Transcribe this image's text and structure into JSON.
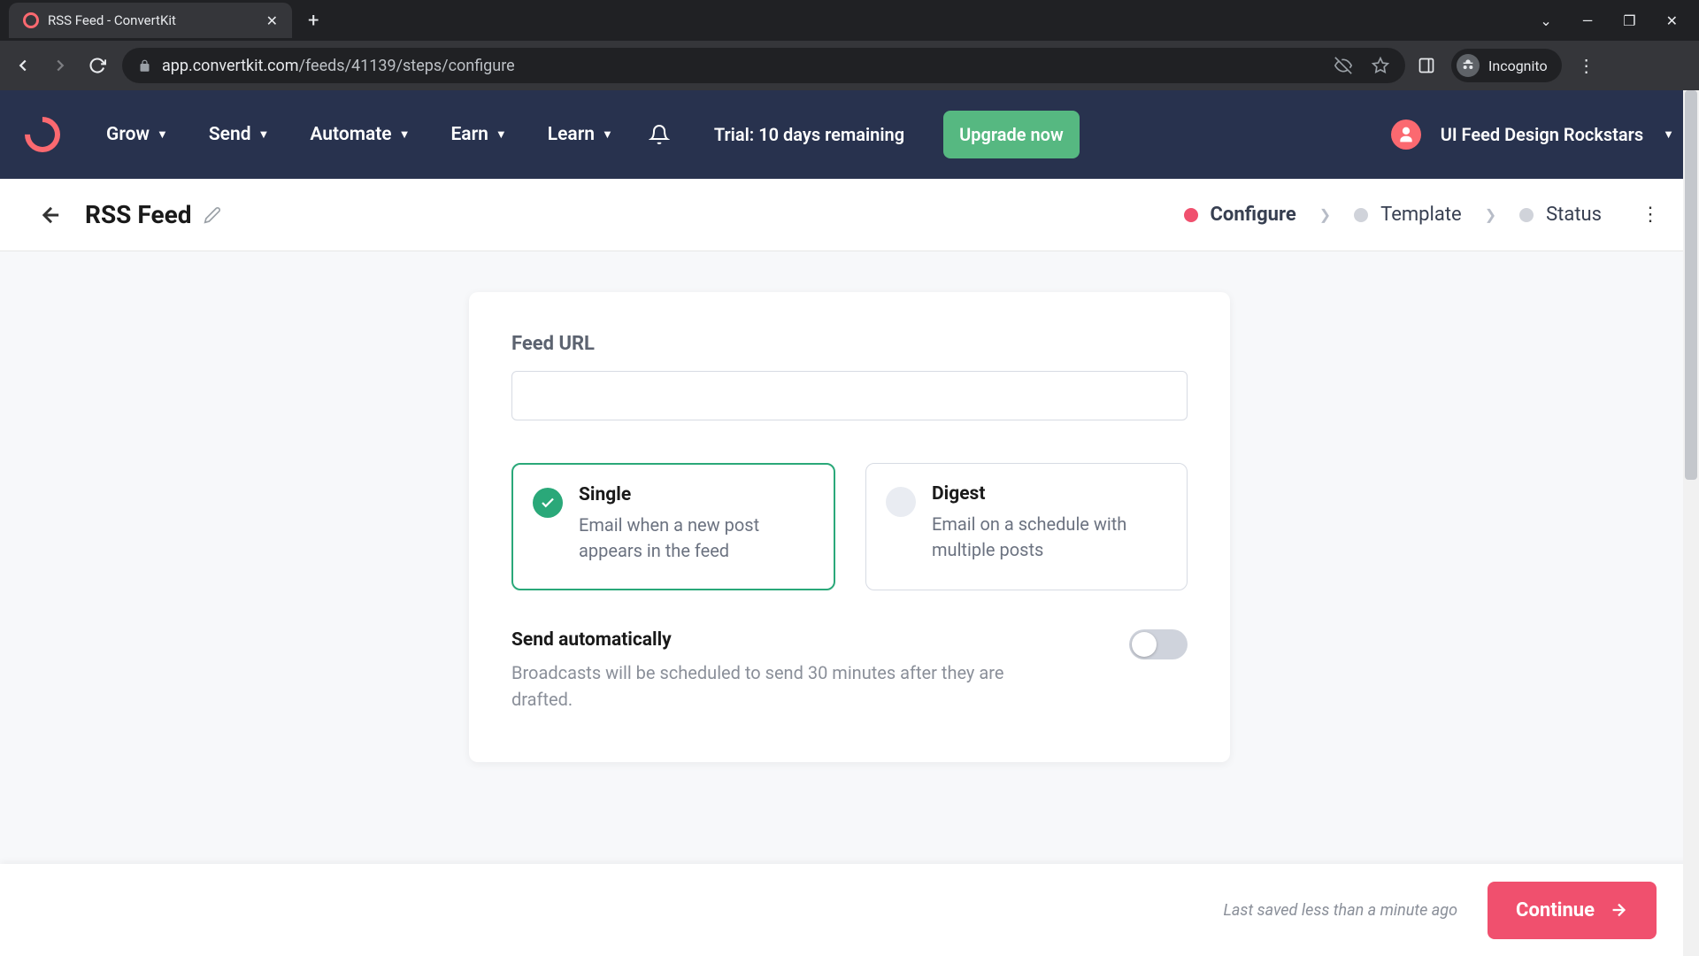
{
  "browser": {
    "tab_title": "RSS Feed - ConvertKit",
    "url_host": "app.convertkit.com",
    "url_path": "/feeds/41139/steps/configure",
    "incognito_label": "Incognito"
  },
  "nav": {
    "items": [
      "Grow",
      "Send",
      "Automate",
      "Earn",
      "Learn"
    ],
    "trial_text": "Trial: 10 days remaining",
    "upgrade_label": "Upgrade now",
    "account_name": "UI Feed Design Rockstars"
  },
  "subheader": {
    "title": "RSS Feed",
    "steps": [
      "Configure",
      "Template",
      "Status"
    ],
    "active_step": 0
  },
  "form": {
    "feed_url_label": "Feed URL",
    "feed_url_value": "",
    "options": [
      {
        "title": "Single",
        "desc": "Email when a new post appears in the feed",
        "selected": true
      },
      {
        "title": "Digest",
        "desc": "Email on a schedule with multiple posts",
        "selected": false
      }
    ],
    "auto_label": "Send automatically",
    "auto_desc": "Broadcasts will be scheduled to send 30 minutes after they are drafted.",
    "auto_on": false
  },
  "footer": {
    "last_saved": "Last saved less than a minute ago",
    "continue_label": "Continue"
  }
}
